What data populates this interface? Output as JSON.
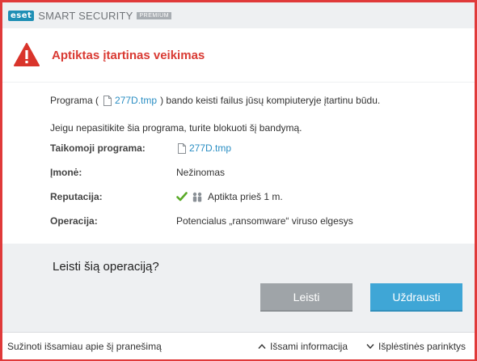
{
  "titlebar": {
    "logo_text": "eset",
    "product_name": "SMART SECURITY",
    "edition": "PREMIUM"
  },
  "alert": {
    "icon": "warning-triangle-icon",
    "title": "Aptiktas įtartinas veikimas"
  },
  "body": {
    "sentence_prefix": "Programa (",
    "file_name": "277D.tmp",
    "sentence_suffix": ") bando keisti failus jūsų kompiuteryje įtartinu būdu.",
    "advice": "Jeigu nepasitikite šia programa, turite blokuoti šį bandymą.",
    "details": [
      {
        "label": "Taikomoji programa:",
        "value": "277D.tmp",
        "type": "file-link"
      },
      {
        "label": "Įmonė:",
        "value": "Nežinomas",
        "type": "link"
      },
      {
        "label": "Reputacija:",
        "value": "Aptikta prieš 1 m.",
        "type": "reputation"
      },
      {
        "label": "Operacija:",
        "value": "Potencialus „ransomware“ viruso elgesys",
        "type": "text"
      }
    ]
  },
  "question": {
    "text": "Leisti šią operaciją?",
    "allow_label": "Leisti",
    "block_label": "Uždrausti"
  },
  "footer": {
    "learn_more": "Sužinoti išsamiau apie šį pranešimą",
    "details_label": "Išsami informacija",
    "advanced_label": "Išplėstinės parinktys"
  },
  "colors": {
    "border": "#e03a3a",
    "alert_title": "#d93a33",
    "link": "#2a8ec3",
    "block_button": "#3fa6d6",
    "allow_button": "#9fa4a8",
    "check": "#5aaa28"
  }
}
